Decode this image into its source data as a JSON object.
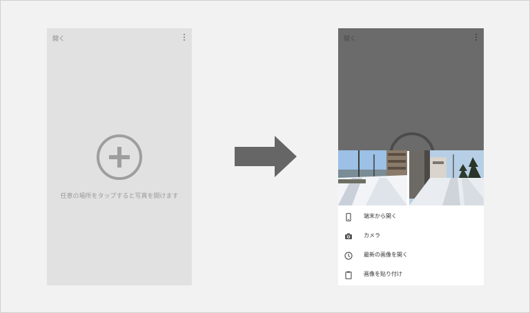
{
  "left_screen": {
    "open_label": "開く",
    "hint_text": "任意の場所をタップすると写真を開けます"
  },
  "right_screen": {
    "open_label": "開く",
    "sheet_items": [
      {
        "label": "端末から開く",
        "icon": "phone-icon"
      },
      {
        "label": "カメラ",
        "icon": "camera-icon"
      },
      {
        "label": "最新の画像を開く",
        "icon": "clock-icon"
      },
      {
        "label": "画像を貼り付け",
        "icon": "clipboard-icon"
      }
    ]
  },
  "colors": {
    "background": "#f2f2f2",
    "left_panel": "#e1e1e1",
    "overlay": "#6b6b6b",
    "arrow": "#666666"
  }
}
